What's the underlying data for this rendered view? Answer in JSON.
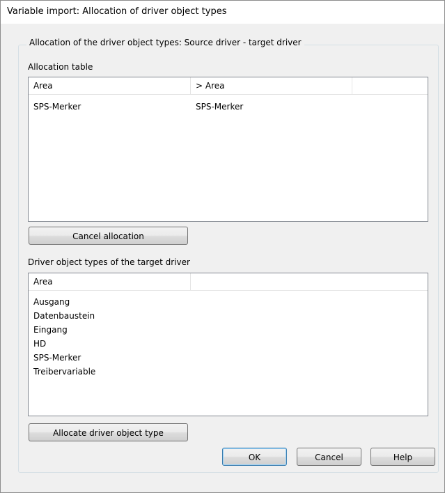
{
  "window": {
    "title": "Variable import: Allocation of driver object types"
  },
  "group": {
    "title": "Allocation of the driver object types: Source driver - target driver"
  },
  "allocation_table": {
    "label": "Allocation table",
    "columns": [
      "Area",
      "> Area",
      ""
    ],
    "rows": [
      {
        "area": "SPS-Merker",
        "target_area": "SPS-Merker"
      }
    ]
  },
  "cancel_allocation_label": "Cancel allocation",
  "target_types": {
    "label": "Driver object types of the target driver",
    "columns": [
      "Area",
      ""
    ],
    "items": [
      "Ausgang",
      "Datenbaustein",
      "Eingang",
      "HD",
      "SPS-Merker",
      "Treibervariable"
    ]
  },
  "allocate_label": "Allocate driver object type",
  "buttons": {
    "ok": "OK",
    "cancel": "Cancel",
    "help": "Help"
  }
}
